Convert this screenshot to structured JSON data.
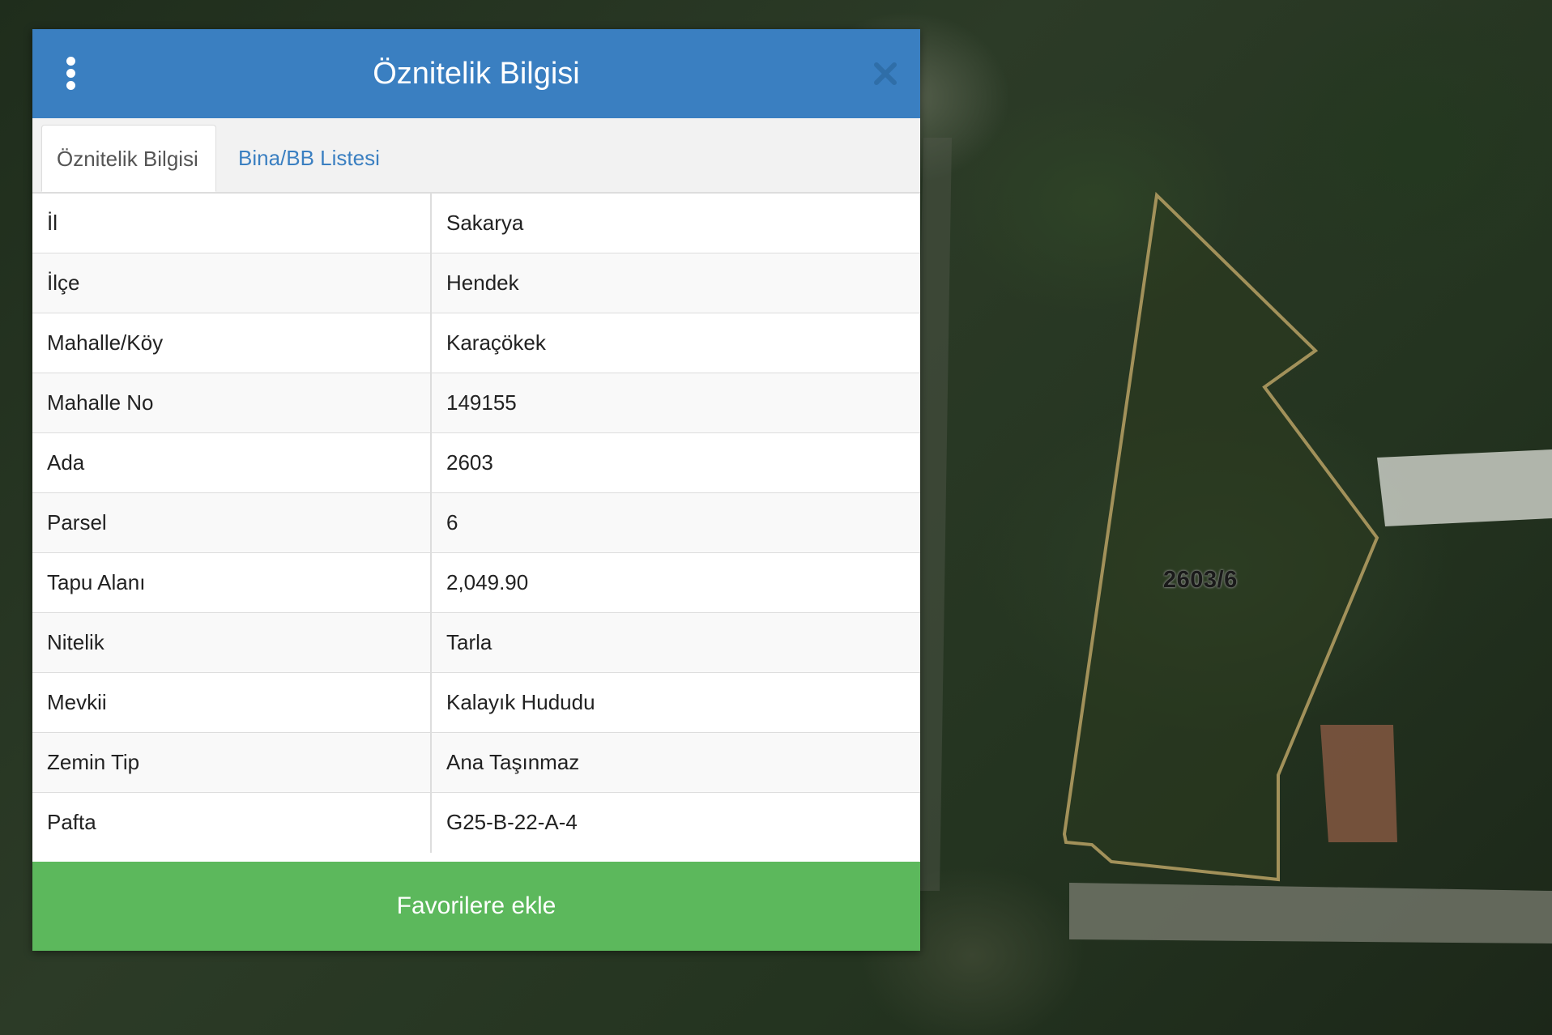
{
  "map": {
    "parcel_label": "2603/6",
    "parcel_outline_color": "#a2915a"
  },
  "panel": {
    "title": "Öznitelik Bilgisi",
    "menu_icon": "kebab-vertical-icon",
    "close_icon": "close-icon",
    "header_color": "#3a7fc1",
    "tabs": [
      {
        "label": "Öznitelik Bilgisi",
        "active": true
      },
      {
        "label": "Bina/BB Listesi",
        "active": false
      }
    ],
    "rows": [
      {
        "key": "İl",
        "value": "Sakarya"
      },
      {
        "key": "İlçe",
        "value": "Hendek"
      },
      {
        "key": "Mahalle/Köy",
        "value": "Karaçökek"
      },
      {
        "key": "Mahalle No",
        "value": "149155"
      },
      {
        "key": "Ada",
        "value": "2603"
      },
      {
        "key": "Parsel",
        "value": "6"
      },
      {
        "key": "Tapu Alanı",
        "value": "2,049.90"
      },
      {
        "key": "Nitelik",
        "value": "Tarla"
      },
      {
        "key": "Mevkii",
        "value": "Kalayık Hududu"
      },
      {
        "key": "Zemin Tip",
        "value": "Ana Taşınmaz"
      },
      {
        "key": "Pafta",
        "value": "G25-B-22-A-4"
      }
    ],
    "favorite_button_label": "Favorilere ekle",
    "favorite_button_color": "#5cb85c"
  }
}
